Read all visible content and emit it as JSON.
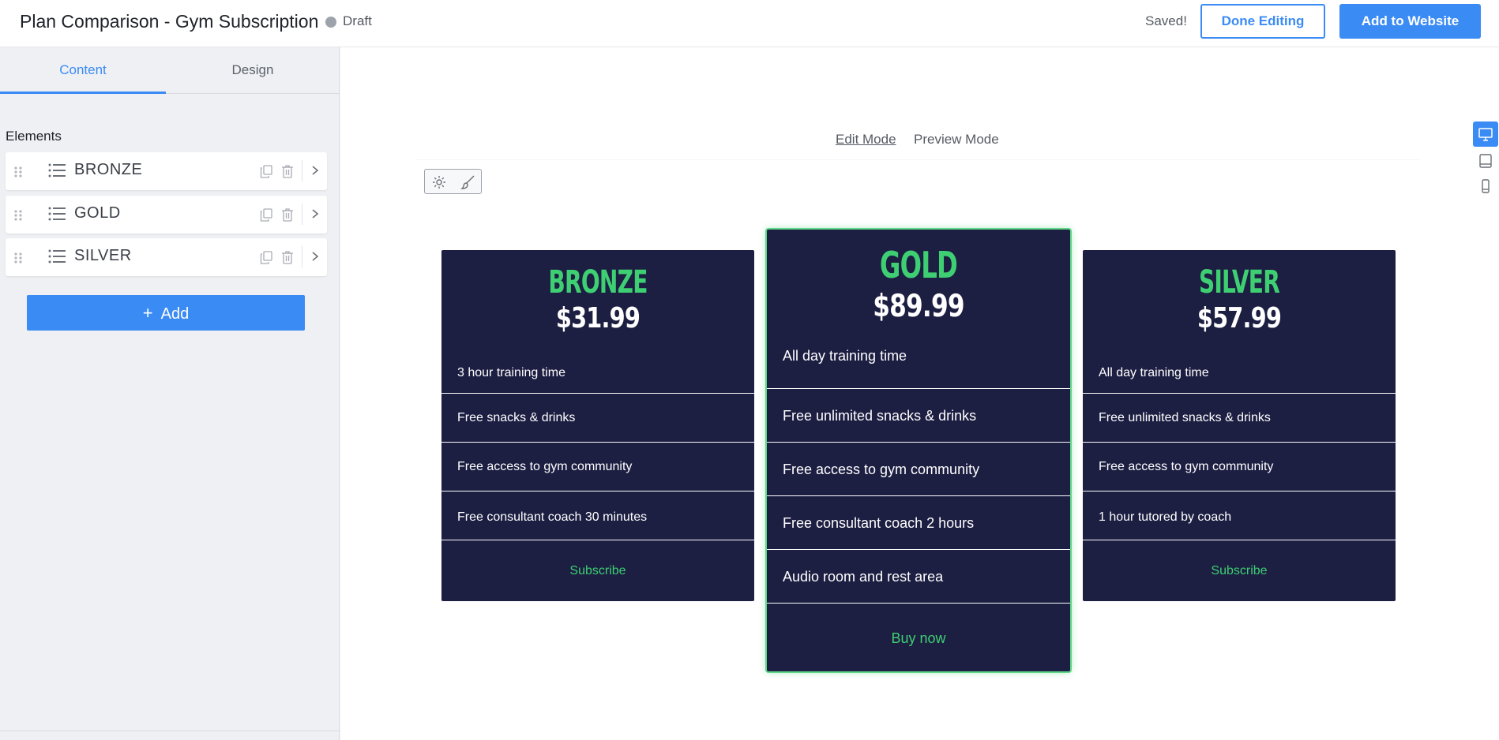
{
  "header": {
    "title": "Plan Comparison - Gym Subscription",
    "status": "Draft",
    "saved": "Saved!",
    "done_editing": "Done Editing",
    "add_to_website": "Add to Website"
  },
  "sidebar": {
    "tabs": [
      {
        "label": "Content",
        "active": true
      },
      {
        "label": "Design",
        "active": false
      }
    ],
    "elements_label": "Elements",
    "items": [
      {
        "label": "BRONZE"
      },
      {
        "label": "GOLD"
      },
      {
        "label": "SILVER"
      }
    ],
    "add_label": "Add"
  },
  "canvas": {
    "modes": {
      "edit": "Edit Mode",
      "preview": "Preview Mode",
      "active": "edit"
    },
    "devices": [
      "desktop-icon",
      "tablet-icon",
      "mobile-icon"
    ]
  },
  "plans": [
    {
      "name": "BRONZE",
      "price": "$31.99",
      "features": [
        "3 hour training time",
        "Free snacks & drinks",
        "Free access to gym community",
        "Free consultant coach 30 minutes"
      ],
      "cta": "Subscribe"
    },
    {
      "name": "GOLD",
      "price": "$89.99",
      "features": [
        "All day training time",
        "Free unlimited snacks & drinks",
        "Free access to gym community",
        "Free consultant coach 2 hours",
        "Audio room and rest area"
      ],
      "cta": "Buy now",
      "highlighted": true
    },
    {
      "name": "SILVER",
      "price": "$57.99",
      "features": [
        "All day training time",
        "Free unlimited snacks & drinks",
        "Free access to gym community",
        "1 hour tutored by coach"
      ],
      "cta": "Subscribe"
    }
  ],
  "colors": {
    "accent": "#3b8bf5",
    "card_bg": "#1c1e42",
    "plan_green": "#3ecf72",
    "status_dot": "#9ea2ab"
  }
}
